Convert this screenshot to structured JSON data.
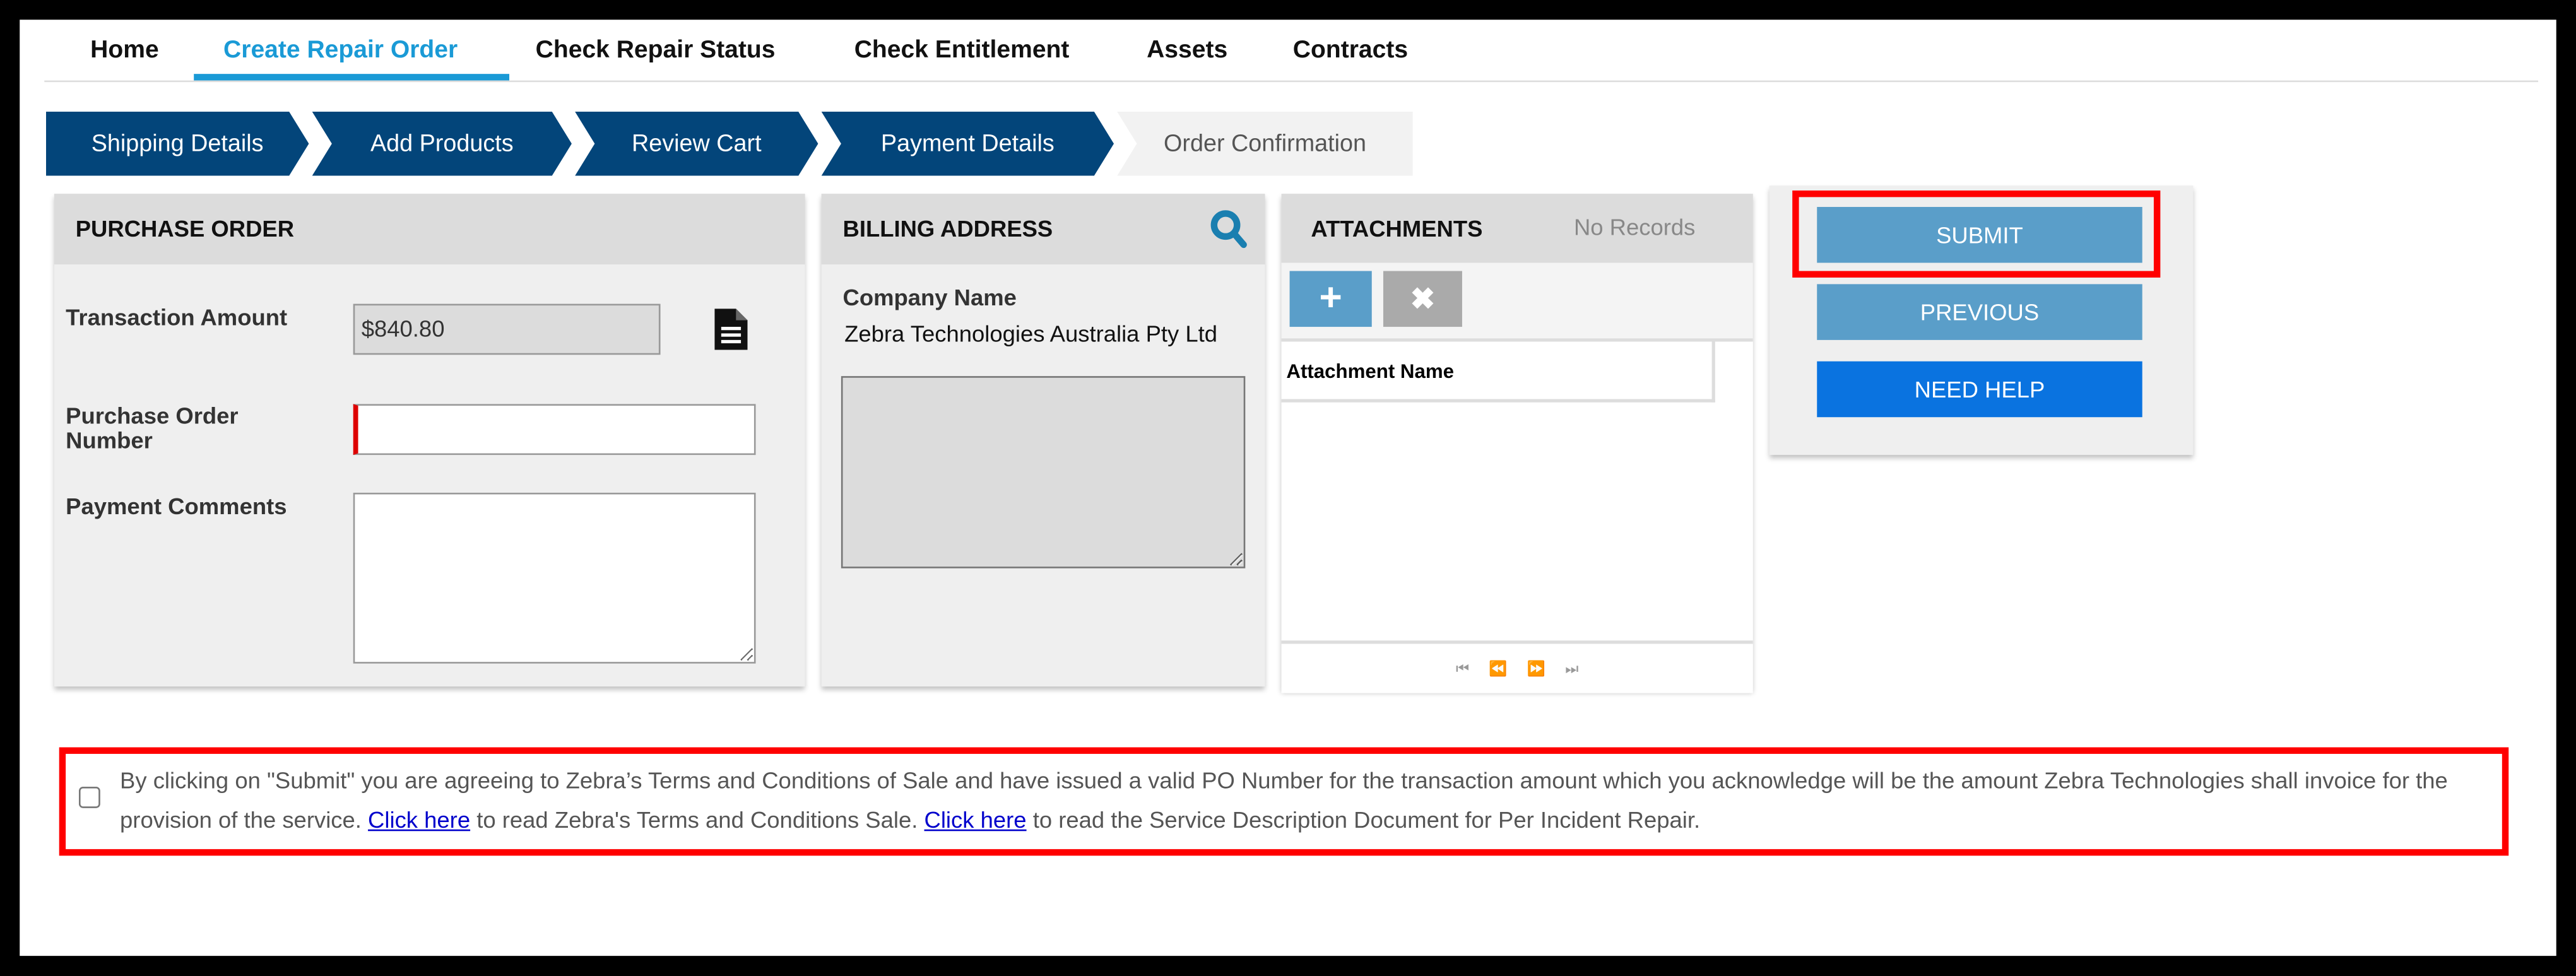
{
  "nav": {
    "items": [
      "Home",
      "Create Repair Order",
      "Check Repair Status",
      "Check Entitlement",
      "Assets",
      "Contracts"
    ],
    "active": "Create Repair Order"
  },
  "steps": [
    "Shipping Details",
    "Add Products",
    "Review Cart",
    "Payment Details",
    "Order Confirmation"
  ],
  "purchase_order": {
    "title": "PURCHASE ORDER",
    "transaction_amount_label": "Transaction Amount",
    "transaction_amount_value": "$840.80",
    "po_number_label": "Purchase Order Number",
    "po_number_value": "",
    "payment_comments_label": "Payment Comments",
    "payment_comments_value": ""
  },
  "billing": {
    "title": "BILLING ADDRESS",
    "company_label": "Company Name",
    "company_value": "Zebra Technologies Australia Pty Ltd",
    "address_value": ""
  },
  "attachments": {
    "title": "ATTACHMENTS",
    "status": "No Records",
    "column": "Attachment Name"
  },
  "actions": {
    "submit": "SUBMIT",
    "previous": "PREVIOUS",
    "need_help": "NEED HELP"
  },
  "terms": {
    "text1": "By clicking on \"Submit\" you are agreeing to Zebra’s Terms and Conditions of Sale and have issued a valid PO Number for the transaction amount which you acknowledge will be the amount Zebra Technologies shall invoice for the provision of the service. ",
    "link1": "Click here",
    "text2": " to read Zebra's Terms and Conditions Sale. ",
    "link2": "Click here",
    "text3": " to read the Service Description Document for Per Incident Repair.",
    "checked": false
  },
  "colors": {
    "accent": "#1a9ad6",
    "step": "#03457a",
    "button": "#5a9ec9",
    "help": "#0a73e0",
    "highlight": "#ff0000"
  }
}
